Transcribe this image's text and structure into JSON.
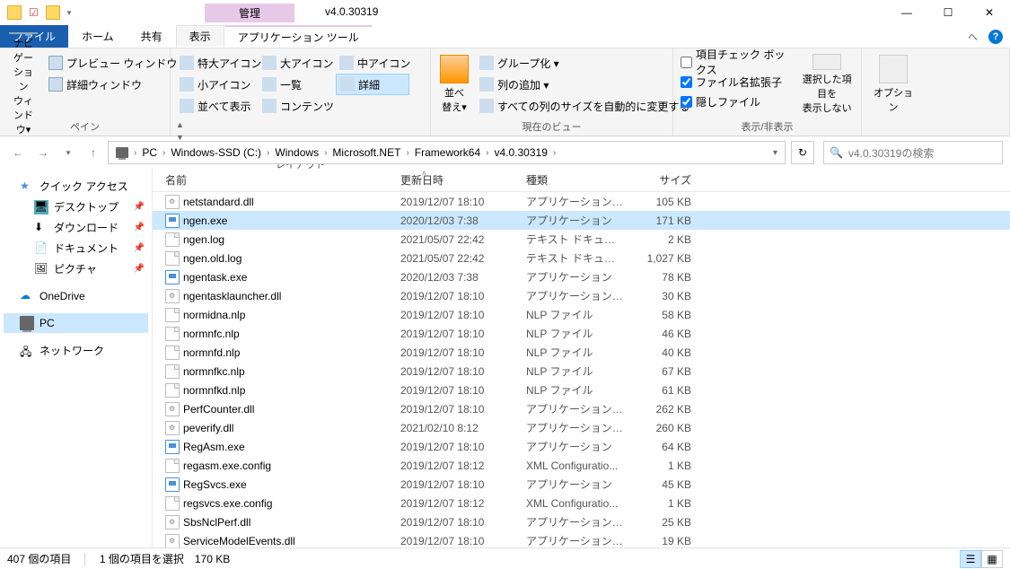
{
  "title_bar": {
    "contextual_label": "管理",
    "window_title": "v4.0.30319",
    "min": "—",
    "max": "☐",
    "close": "✕"
  },
  "tabs": {
    "file": "ファイル",
    "home": "ホーム",
    "share": "共有",
    "view": "表示",
    "app_tools": "アプリケーション ツール"
  },
  "ribbon": {
    "panes": {
      "nav_pane": "ナビゲーション\nウィンドウ▾",
      "preview": "プレビュー ウィンドウ",
      "details": "詳細ウィンドウ",
      "group": "ペイン"
    },
    "layout": {
      "extra_large": "特大アイコン",
      "large": "大アイコン",
      "medium": "中アイコン",
      "small": "小アイコン",
      "list": "一覧",
      "details": "詳細",
      "tiles": "並べて表示",
      "content": "コンテンツ",
      "group": "レイアウト"
    },
    "current_view": {
      "sort": "並べ替え▾",
      "group_by": "グループ化 ▾",
      "add_columns": "列の追加 ▾",
      "size_all": "すべての列のサイズを自動的に変更する",
      "group": "現在のビュー"
    },
    "show_hide": {
      "item_check": "項目チェック ボックス",
      "file_ext": "ファイル名拡張子",
      "hidden": "隠しファイル",
      "hide_selected": "選択した項目を\n表示しない",
      "group": "表示/非表示"
    },
    "options": {
      "options": "オプション",
      "group": ""
    }
  },
  "breadcrumb": {
    "items": [
      "PC",
      "Windows-SSD (C:)",
      "Windows",
      "Microsoft.NET",
      "Framework64",
      "v4.0.30319"
    ]
  },
  "search": {
    "placeholder": "v4.0.30319の検索"
  },
  "sidebar": {
    "quick_access": "クイック アクセス",
    "desktop": "デスクトップ",
    "downloads": "ダウンロード",
    "documents": "ドキュメント",
    "pictures": "ピクチャ",
    "onedrive": "OneDrive",
    "pc": "PC",
    "network": "ネットワーク"
  },
  "columns": {
    "name": "名前",
    "date": "更新日時",
    "type": "種類",
    "size": "サイズ"
  },
  "files": [
    {
      "name": "netstandard.dll",
      "date": "2019/12/07 18:10",
      "type": "アプリケーション拡張",
      "size": "105 KB",
      "icon": "dll"
    },
    {
      "name": "ngen.exe",
      "date": "2020/12/03 7:38",
      "type": "アプリケーション",
      "size": "171 KB",
      "icon": "exe",
      "selected": true
    },
    {
      "name": "ngen.log",
      "date": "2021/05/07 22:42",
      "type": "テキスト ドキュメント",
      "size": "2 KB",
      "icon": "file"
    },
    {
      "name": "ngen.old.log",
      "date": "2021/05/07 22:42",
      "type": "テキスト ドキュメント",
      "size": "1,027 KB",
      "icon": "file"
    },
    {
      "name": "ngentask.exe",
      "date": "2020/12/03 7:38",
      "type": "アプリケーション",
      "size": "78 KB",
      "icon": "exe"
    },
    {
      "name": "ngentasklauncher.dll",
      "date": "2019/12/07 18:10",
      "type": "アプリケーション拡張",
      "size": "30 KB",
      "icon": "dll"
    },
    {
      "name": "normidna.nlp",
      "date": "2019/12/07 18:10",
      "type": "NLP ファイル",
      "size": "58 KB",
      "icon": "file"
    },
    {
      "name": "normnfc.nlp",
      "date": "2019/12/07 18:10",
      "type": "NLP ファイル",
      "size": "46 KB",
      "icon": "file"
    },
    {
      "name": "normnfd.nlp",
      "date": "2019/12/07 18:10",
      "type": "NLP ファイル",
      "size": "40 KB",
      "icon": "file"
    },
    {
      "name": "normnfkc.nlp",
      "date": "2019/12/07 18:10",
      "type": "NLP ファイル",
      "size": "67 KB",
      "icon": "file"
    },
    {
      "name": "normnfkd.nlp",
      "date": "2019/12/07 18:10",
      "type": "NLP ファイル",
      "size": "61 KB",
      "icon": "file"
    },
    {
      "name": "PerfCounter.dll",
      "date": "2019/12/07 18:10",
      "type": "アプリケーション拡張",
      "size": "262 KB",
      "icon": "dll"
    },
    {
      "name": "peverify.dll",
      "date": "2021/02/10 8:12",
      "type": "アプリケーション拡張",
      "size": "260 KB",
      "icon": "dll"
    },
    {
      "name": "RegAsm.exe",
      "date": "2019/12/07 18:10",
      "type": "アプリケーション",
      "size": "64 KB",
      "icon": "exe"
    },
    {
      "name": "regasm.exe.config",
      "date": "2019/12/07 18:12",
      "type": "XML Configuratio...",
      "size": "1 KB",
      "icon": "file"
    },
    {
      "name": "RegSvcs.exe",
      "date": "2019/12/07 18:10",
      "type": "アプリケーション",
      "size": "45 KB",
      "icon": "exe"
    },
    {
      "name": "regsvcs.exe.config",
      "date": "2019/12/07 18:12",
      "type": "XML Configuratio...",
      "size": "1 KB",
      "icon": "file"
    },
    {
      "name": "SbsNclPerf.dll",
      "date": "2019/12/07 18:10",
      "type": "アプリケーション拡張",
      "size": "25 KB",
      "icon": "dll"
    },
    {
      "name": "ServiceModelEvents.dll",
      "date": "2019/12/07 18:10",
      "type": "アプリケーション拡張",
      "size": "19 KB",
      "icon": "dll"
    }
  ],
  "statusbar": {
    "item_count": "407 個の項目",
    "selection": "1 個の項目を選択",
    "selection_size": "170 KB"
  }
}
